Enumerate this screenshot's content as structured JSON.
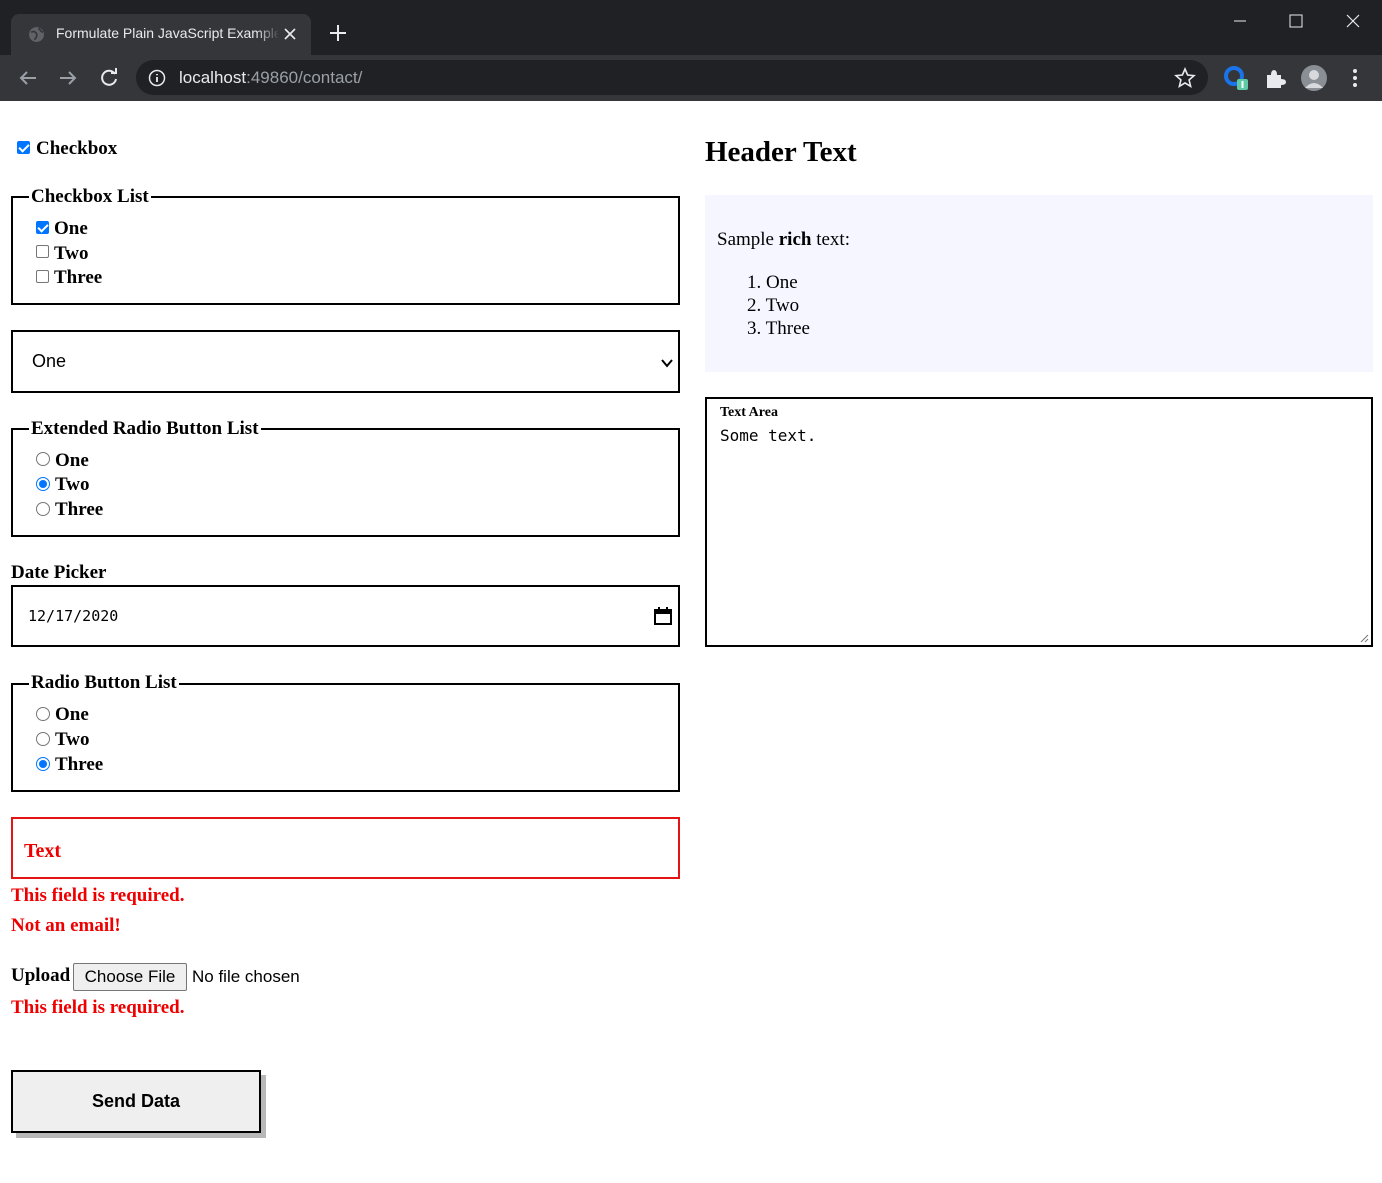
{
  "browser": {
    "tab_title": "Formulate Plain JavaScript Example",
    "url_host": "localhost",
    "url_rest": ":49860/contact/"
  },
  "form": {
    "checkbox": {
      "label": "Checkbox",
      "checked": true
    },
    "checkbox_list": {
      "legend": "Checkbox List",
      "options": [
        {
          "label": "One",
          "checked": true
        },
        {
          "label": "Two",
          "checked": false
        },
        {
          "label": "Three",
          "checked": false
        }
      ]
    },
    "select": {
      "value": "One"
    },
    "extended_radio_list": {
      "legend": "Extended Radio Button List",
      "options": [
        {
          "label": "One",
          "checked": false
        },
        {
          "label": "Two",
          "checked": true
        },
        {
          "label": "Three",
          "checked": false
        }
      ]
    },
    "date_picker": {
      "label": "Date Picker",
      "value": "12/17/2020"
    },
    "radio_list": {
      "legend": "Radio Button List",
      "options": [
        {
          "label": "One",
          "checked": false
        },
        {
          "label": "Two",
          "checked": false
        },
        {
          "label": "Three",
          "checked": true
        }
      ]
    },
    "text_field": {
      "label": "Text",
      "errors": [
        "This field is required.",
        "Not an email!"
      ]
    },
    "upload": {
      "label": "Upload",
      "button": "Choose File",
      "status": "No file chosen",
      "error": "This field is required."
    },
    "submit": "Send Data"
  },
  "side": {
    "header": "Header Text",
    "rich_text": {
      "prefix": "Sample ",
      "bold": "rich",
      "suffix": " text:",
      "items": [
        "One",
        "Two",
        "Three"
      ]
    },
    "text_area": {
      "label": "Text Area",
      "value": "Some text."
    }
  },
  "colors": {
    "error": "#e00000",
    "accent": "#0075ff",
    "rich_bg": "#f5f6ff"
  }
}
